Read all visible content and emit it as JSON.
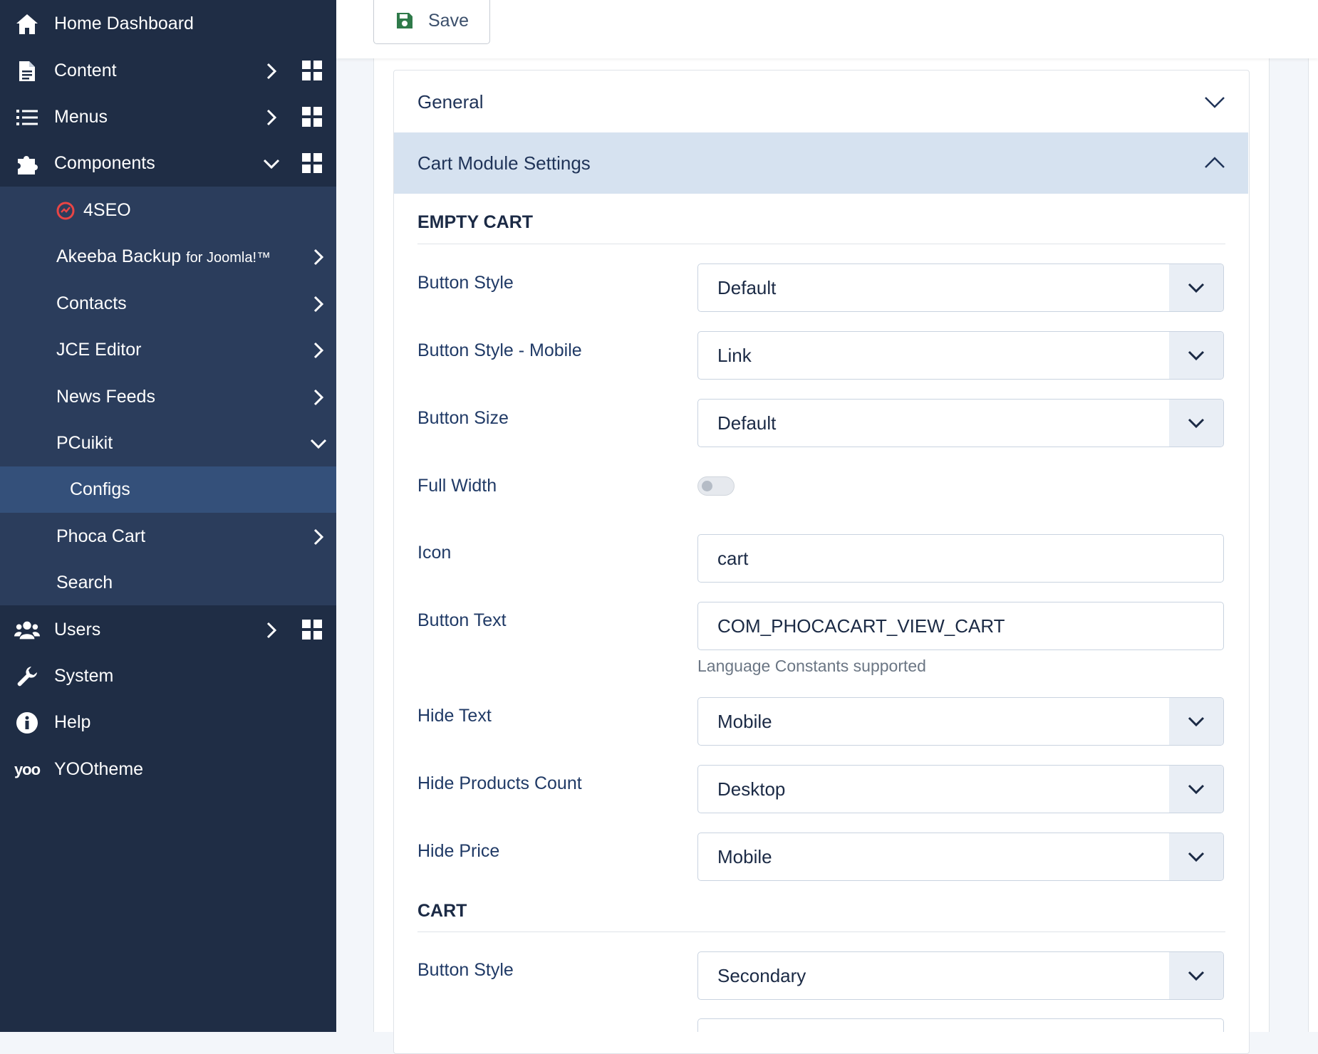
{
  "sidebar": {
    "top_items": [
      {
        "label": "Home Dashboard",
        "icon": "home-icon"
      },
      {
        "label": "Content",
        "icon": "file-icon"
      },
      {
        "label": "Menus",
        "icon": "list-icon"
      },
      {
        "label": "Components",
        "icon": "puzzle-icon"
      }
    ],
    "sub_items": [
      {
        "label": "4SEO"
      },
      {
        "label": "Akeeba Backup",
        "suffix": "for Joomla!™"
      },
      {
        "label": "Contacts"
      },
      {
        "label": "JCE Editor"
      },
      {
        "label": "News Feeds"
      },
      {
        "label": "PCuikit"
      },
      {
        "label": "Configs"
      },
      {
        "label": "Phoca Cart"
      },
      {
        "label": "Search"
      }
    ],
    "bottom_items": [
      {
        "label": "Users",
        "icon": "users-icon"
      },
      {
        "label": "System",
        "icon": "wrench-icon"
      },
      {
        "label": "Help",
        "icon": "info-icon"
      },
      {
        "label": "YOOtheme",
        "icon": "yootheme-icon"
      }
    ]
  },
  "toolbar": {
    "save_label": "Save"
  },
  "accordion": {
    "general": "General",
    "cart_module_settings": "Cart Module Settings"
  },
  "sections": {
    "empty_cart": "EMPTY CART",
    "cart": "CART"
  },
  "fields": {
    "button_style": {
      "label": "Button Style",
      "value": "Default"
    },
    "button_style_mobile": {
      "label": "Button Style - Mobile",
      "value": "Link"
    },
    "button_size": {
      "label": "Button Size",
      "value": "Default"
    },
    "full_width": {
      "label": "Full Width",
      "value": false
    },
    "icon": {
      "label": "Icon",
      "value": "cart"
    },
    "button_text": {
      "label": "Button Text",
      "value": "COM_PHOCACART_VIEW_CART",
      "hint": "Language Constants supported"
    },
    "hide_text": {
      "label": "Hide Text",
      "value": "Mobile"
    },
    "hide_products_count": {
      "label": "Hide Products Count",
      "value": "Desktop"
    },
    "hide_price": {
      "label": "Hide Price",
      "value": "Mobile"
    },
    "cart_button_style": {
      "label": "Button Style",
      "value": "Secondary"
    }
  },
  "colors": {
    "sidebar_bg": "#1f2d45",
    "submenu_bg": "#2b3d5c",
    "active_bg": "#34507a",
    "accordion_active": "#d6e2f0",
    "save_icon": "#2f7a4a"
  }
}
